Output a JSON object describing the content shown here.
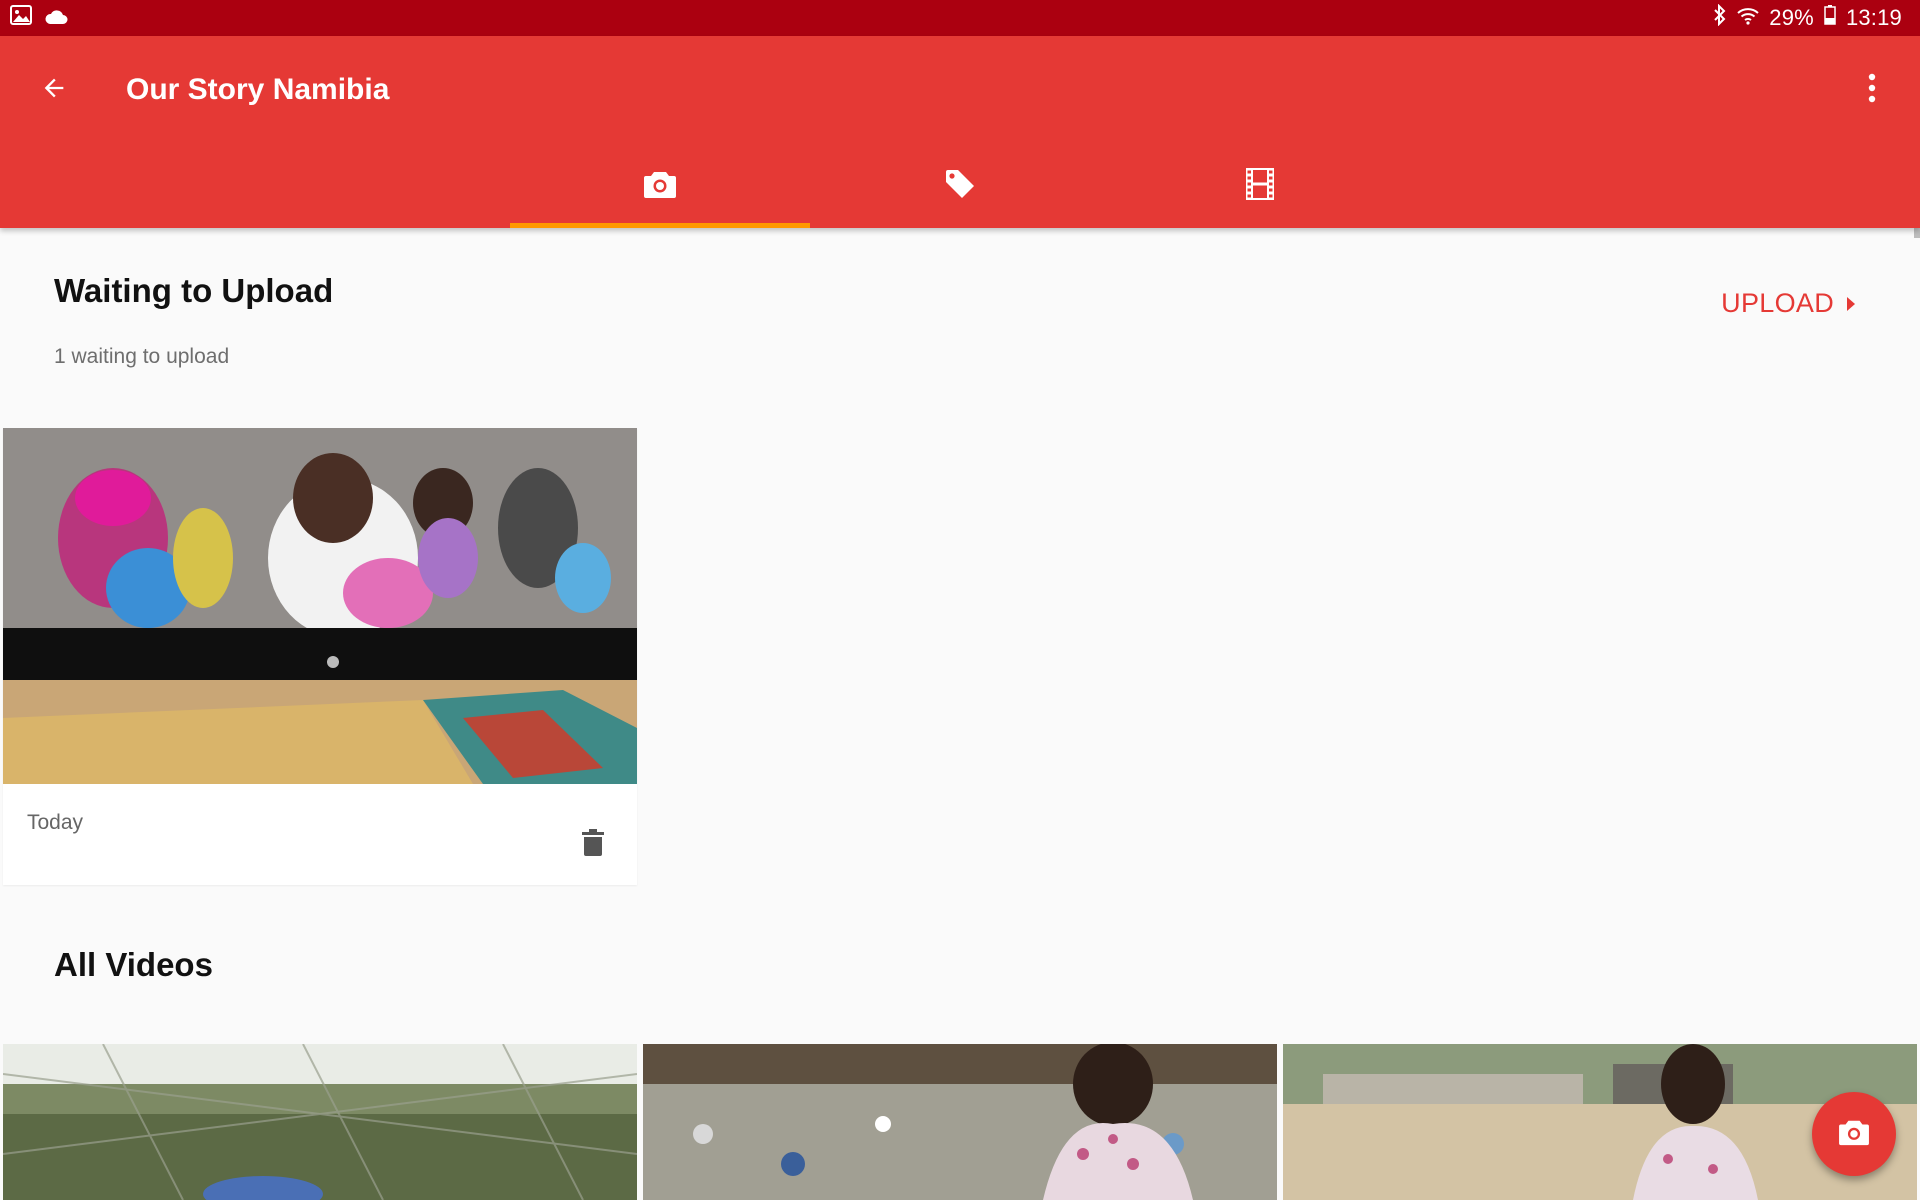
{
  "status_bar": {
    "left_icons": [
      "gallery-icon",
      "cloud-icon"
    ],
    "right_icons": [
      "bluetooth-icon",
      "wifi-icon",
      "battery-icon"
    ],
    "battery": "29%",
    "time": "13:19"
  },
  "app_bar": {
    "title": "Our Story Namibia",
    "back_icon": "arrow-back-icon",
    "menu_icon": "more-vert-icon",
    "tabs": [
      {
        "icon": "camera-icon",
        "selected": true
      },
      {
        "icon": "tag-icon",
        "selected": false
      },
      {
        "icon": "film-icon",
        "selected": false
      }
    ],
    "colors": {
      "primary": "#e53935",
      "status": "#ab0010",
      "indicator": "#ff9800"
    }
  },
  "waiting": {
    "title": "Waiting to Upload",
    "subtitle": "1 waiting to upload",
    "upload_label": "UPLOAD",
    "items": [
      {
        "date": "Today",
        "delete_icon": "trash-icon"
      }
    ]
  },
  "all_videos": {
    "title": "All Videos"
  },
  "fab": {
    "icon": "camera-icon"
  }
}
